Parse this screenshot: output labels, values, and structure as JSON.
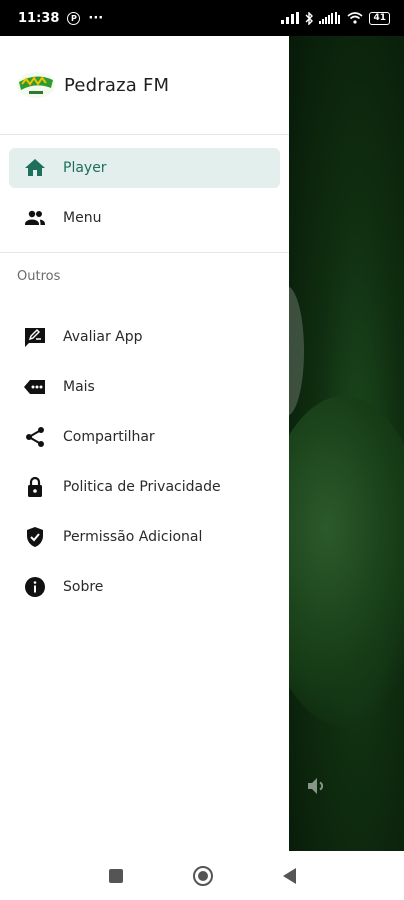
{
  "status_bar": {
    "time": "11:38",
    "notification_icon": "p-circle-icon",
    "more": "···",
    "battery": "41"
  },
  "drawer": {
    "logo_icon": "pedraza-fm-logo",
    "app_title": "Pedraza FM",
    "primary_items": [
      {
        "label": "Player",
        "icon": "home-icon",
        "active": true
      },
      {
        "label": "Menu",
        "icon": "people-icon",
        "active": false
      }
    ],
    "section_title": "Outros",
    "secondary_items": [
      {
        "label": "Avaliar App",
        "icon": "rate-review-icon"
      },
      {
        "label": "Mais",
        "icon": "more-tag-icon"
      },
      {
        "label": "Compartilhar",
        "icon": "share-icon"
      },
      {
        "label": "Politica de Privacidade",
        "icon": "lock-icon"
      },
      {
        "label": "Permissão Adicional",
        "icon": "shield-check-icon"
      },
      {
        "label": "Sobre",
        "icon": "info-icon"
      }
    ]
  },
  "background": {
    "volume_icon": "volume-icon"
  },
  "colors": {
    "accent": "#1e6f5c",
    "active_bg": "#e2efec",
    "behind_bg": "#0f2d10"
  }
}
